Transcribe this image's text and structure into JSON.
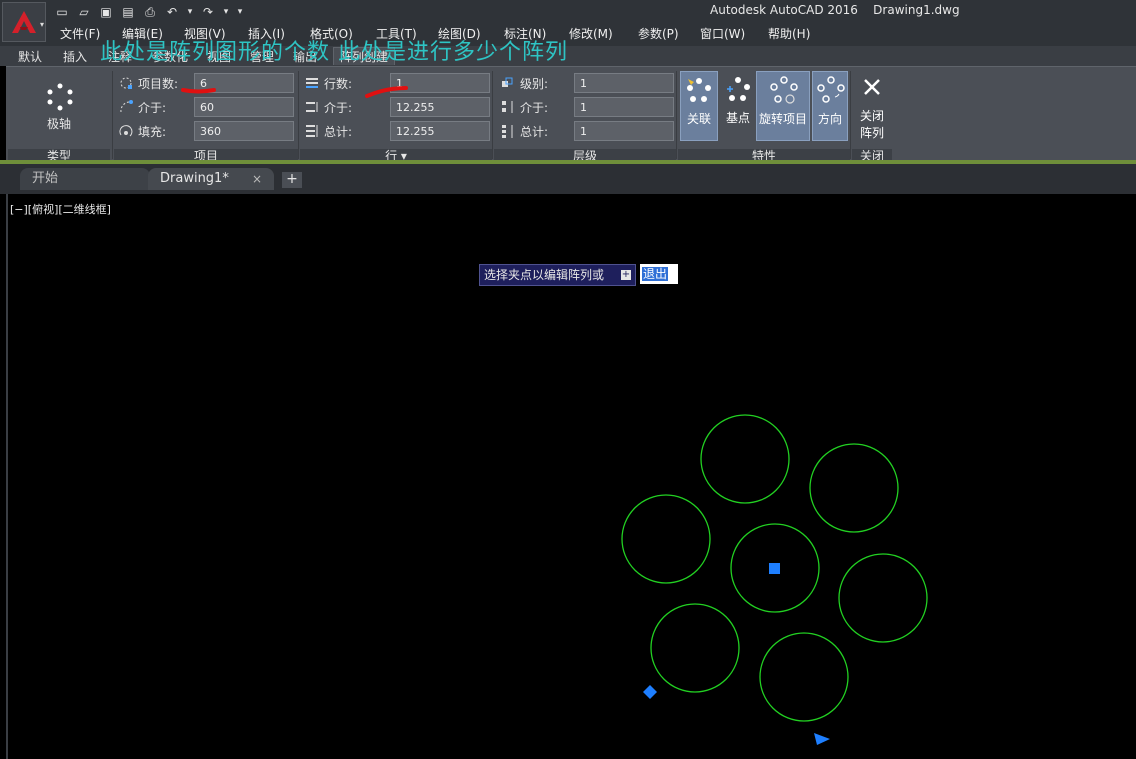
{
  "window": {
    "title": "Autodesk AutoCAD 2016    Drawing1.dwg"
  },
  "app_button": {
    "icon": "autocad-logo-icon"
  },
  "quick_access": [
    {
      "name": "new-icon",
      "glyph": "▭"
    },
    {
      "name": "open-icon",
      "glyph": "▱"
    },
    {
      "name": "save-icon",
      "glyph": "▣"
    },
    {
      "name": "saveas-icon",
      "glyph": "▤"
    },
    {
      "name": "print-icon",
      "glyph": "⎙"
    },
    {
      "name": "undo-icon",
      "glyph": "↶"
    },
    {
      "name": "undo-dropdown-icon",
      "glyph": "▾"
    },
    {
      "name": "redo-icon",
      "glyph": "↷"
    },
    {
      "name": "redo-dropdown-icon",
      "glyph": "▾"
    },
    {
      "name": "customize-qat-icon",
      "glyph": "▾"
    }
  ],
  "menu": [
    "文件(F)",
    "编辑(E)",
    "视图(V)",
    "插入(I)",
    "格式(O)",
    "工具(T)",
    "绘图(D)",
    "标注(N)",
    "修改(M)",
    "参数(P)",
    "窗口(W)",
    "帮助(H)"
  ],
  "annotation": "此处是阵列图形的个数 此处是进行多少个阵列",
  "ribbon_tabs": [
    "默认",
    "插入",
    "注释",
    "参数化",
    "视图",
    "管理",
    "输出",
    "阵列创建"
  ],
  "ribbon": {
    "type_panel": {
      "button_label": "极轴",
      "footer": "类型"
    },
    "items_panel": {
      "footer": "项目",
      "fields": [
        {
          "label": "项目数:",
          "value": "6"
        },
        {
          "label": "介于:",
          "value": "60"
        },
        {
          "label": "填充:",
          "value": "360"
        }
      ]
    },
    "rows_panel": {
      "footer": "行 ▾",
      "fields": [
        {
          "label": "行数:",
          "value": "1"
        },
        {
          "label": "介于:",
          "value": "12.255"
        },
        {
          "label": "总计:",
          "value": "12.255"
        }
      ]
    },
    "levels_panel": {
      "footer": "层级",
      "fields": [
        {
          "label": "级别:",
          "value": "1"
        },
        {
          "label": "介于:",
          "value": "1"
        },
        {
          "label": "总计:",
          "value": "1"
        }
      ]
    },
    "properties_panel": {
      "footer": "特性",
      "buttons": [
        "关联",
        "基点",
        "旋转项目",
        "方向"
      ]
    },
    "close_panel": {
      "footer": "关闭",
      "button_label_1": "关闭",
      "button_label_2": "阵列"
    }
  },
  "file_tabs": {
    "start": "开始",
    "drawing": "Drawing1*",
    "close_glyph": "×",
    "new_glyph": "+"
  },
  "viewport_label": "[−][俯视][二维线框]",
  "command_prompt": {
    "text": "选择夹点以编辑阵列或",
    "expand_glyph": "+",
    "option": "退出"
  },
  "colors": {
    "circle": "#22d022",
    "grip": "#1e7fff",
    "annotation_text": "#2ec4c4",
    "marker": "#e01010"
  }
}
